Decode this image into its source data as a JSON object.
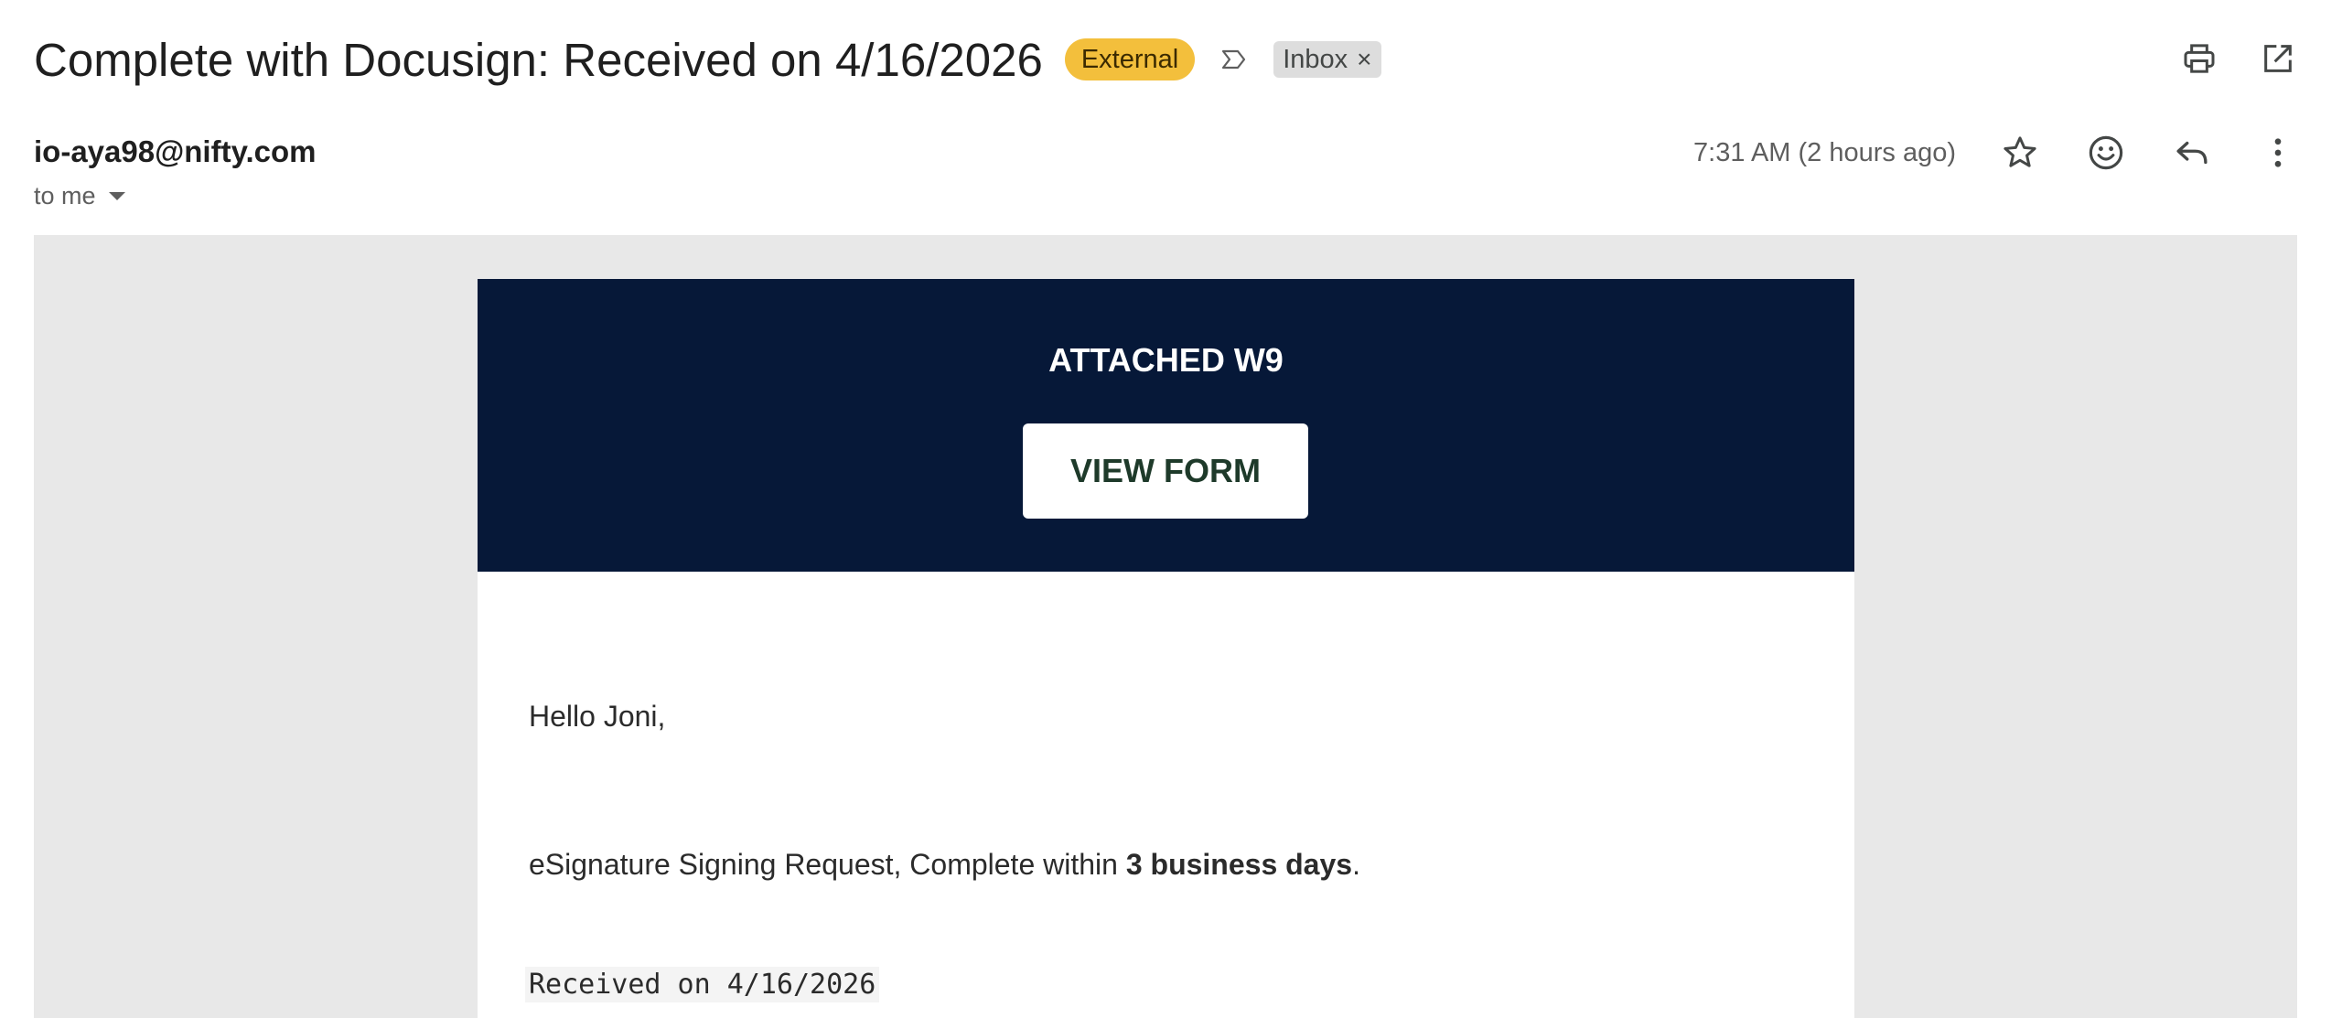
{
  "header": {
    "subject": "Complete with Docusign: Received on 4/16/2026",
    "external_badge": "External",
    "label": "Inbox",
    "label_remove": "×",
    "icons": [
      "important-marker-icon",
      "print-icon",
      "open-in-new-window-icon"
    ]
  },
  "message": {
    "sender": "io-aya98@nifty.com",
    "recipient": "to me",
    "timestamp": "7:31 AM (2 hours ago)",
    "icons": [
      "star-icon",
      "emoji-icon",
      "reply-icon",
      "more-vert-icon"
    ]
  },
  "email": {
    "banner_title": "ATTACHED W9",
    "button_label": "VIEW FORM",
    "greeting": "Hello Joni,",
    "request_prefix": "eSignature Signing Request, Complete within ",
    "request_bold": "3 business days",
    "request_suffix": ".",
    "received_line": "Received on 4/16/2026"
  },
  "colors": {
    "banner_bg": "#061838",
    "external_badge_bg": "#f3bf3c",
    "frame_bg": "#e8e8e8",
    "button_text": "#1e3a2a"
  }
}
